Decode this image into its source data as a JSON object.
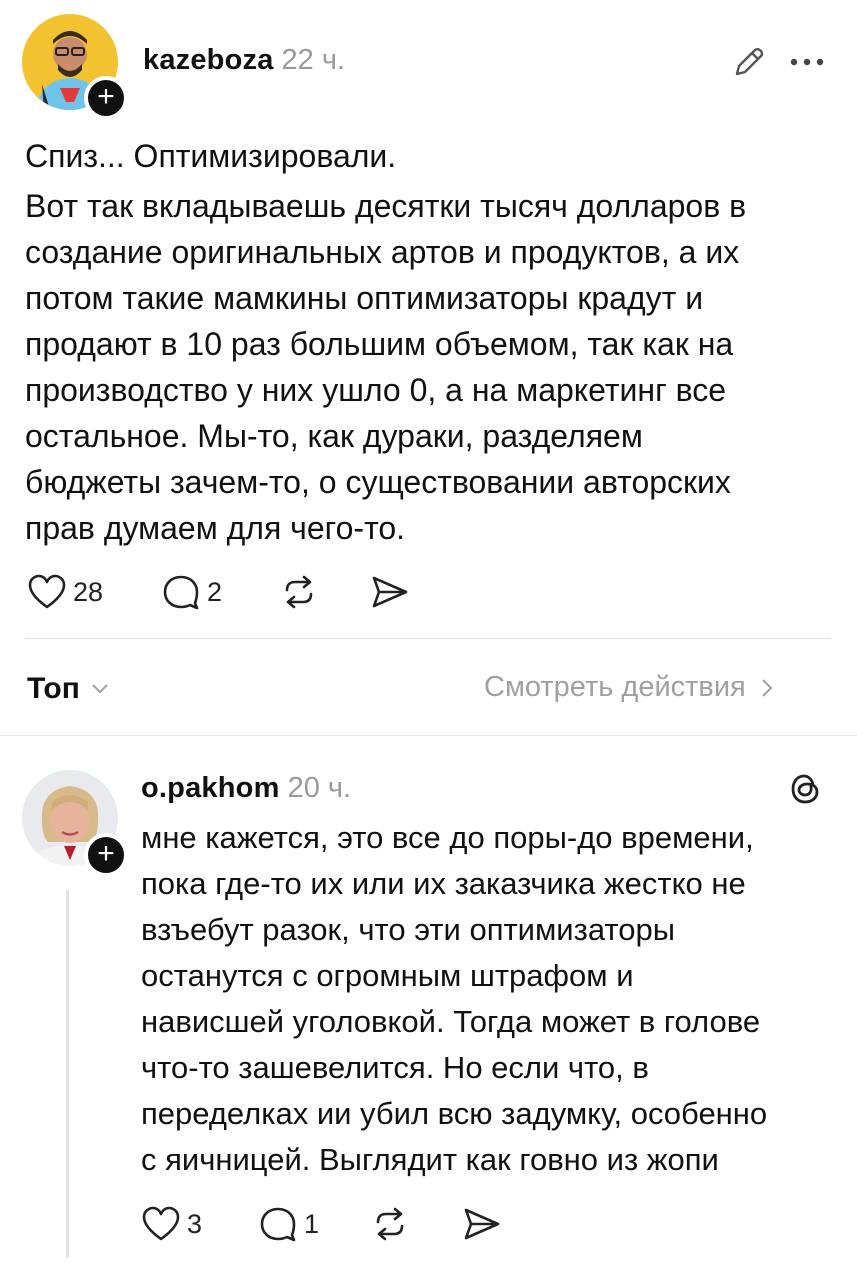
{
  "post": {
    "username": "kazeboza",
    "time": "22 ч.",
    "title_line": "Спиз... Оптимизировали.",
    "body_lines": [
      "Вот так вкладываешь десятки тысяч долларов в",
      "создание оригинальных артов и продуктов, а их",
      "потом такие мамкины оптимизаторы крадут и",
      "продают в 10 раз большим объемом, так как на",
      "производство у них ушло 0, а на маркетинг все",
      "остальное. Мы-то, как дураки, разделяем",
      "бюджеты зачем-то, о существовании авторских",
      "прав думаем для чего-то."
    ],
    "likes": "28",
    "replies": "2"
  },
  "sort_bar": {
    "sort_label": "Топ",
    "view_activity_label": "Смотреть действия"
  },
  "reply": {
    "username": "o.pakhom",
    "time": "20 ч.",
    "lines": [
      "мне кажется, это все до поры-до времени,",
      "пока где-то их или их заказчика жестко не",
      "взъебут разок, что эти оптимизаторы",
      "останутся с огромным штрафом и",
      "нависшей уголовкой. Тогда может в голове",
      "что-то зашевелится. Но если что, в",
      "переделках ии убил всю задумку, особенно",
      "с яичницей. Выглядит как говно из жопи"
    ],
    "likes": "3",
    "replies": "1"
  },
  "icons": {
    "edit": "pencil-icon",
    "more": "more-icon",
    "like": "heart-icon",
    "comment": "comment-icon",
    "repost": "repost-icon",
    "share": "send-icon",
    "threads": "threads-icon",
    "sort_chevron": "chevron-down-icon",
    "activity_chevron": "chevron-right-icon"
  }
}
